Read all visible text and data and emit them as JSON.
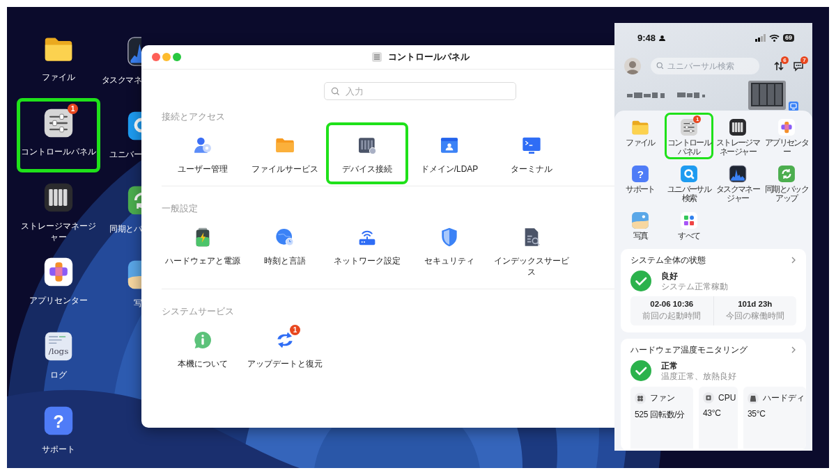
{
  "desktop": {
    "icons": [
      {
        "label": "ファイル",
        "highlighted": false
      },
      {
        "label": "コントロールパネル",
        "badge": "1",
        "highlighted": true
      },
      {
        "label": "ストレージマネージャー",
        "highlighted": false
      },
      {
        "label": "アプリセンター",
        "highlighted": false
      },
      {
        "label": "ログ",
        "icon_text": "/logs",
        "highlighted": false
      },
      {
        "label": "サポート",
        "icon_text": "?",
        "highlighted": false
      }
    ],
    "partly_covered_icons": [
      {
        "label": "タスクマネ"
      },
      {
        "label": "ユニバー"
      },
      {
        "label": "同期とバ"
      },
      {
        "label": "写"
      }
    ]
  },
  "control_panel": {
    "title": "コントロールパネル",
    "search": {
      "placeholder": "入力"
    },
    "sections": [
      {
        "title": "接続とアクセス",
        "items": [
          {
            "label": "ユーザー管理",
            "highlighted": false
          },
          {
            "label": "ファイルサービス",
            "highlighted": false
          },
          {
            "label": "デバイス接続",
            "highlighted": true
          },
          {
            "label": "ドメイン/LDAP",
            "highlighted": false
          },
          {
            "label": "ターミナル",
            "highlighted": false
          }
        ]
      },
      {
        "title": "一般設定",
        "items": [
          {
            "label": "ハードウェアと電源",
            "highlighted": false
          },
          {
            "label": "時刻と言語",
            "highlighted": false
          },
          {
            "label": "ネットワーク設定",
            "highlighted": false
          },
          {
            "label": "セキュリティ",
            "highlighted": false
          },
          {
            "label": "インデックスサービス",
            "highlighted": false
          }
        ]
      },
      {
        "title": "システムサービス",
        "items": [
          {
            "label": "本機について",
            "highlighted": false
          },
          {
            "label": "アップデートと復元",
            "badge": "1",
            "highlighted": false
          }
        ]
      }
    ]
  },
  "phone": {
    "status_bar": {
      "time": "9:48",
      "battery": "69"
    },
    "search": {
      "placeholder": "ユニバーサル検索"
    },
    "transfer_badge": "6",
    "messages_badge": "7",
    "apps": [
      {
        "label": "ファイル",
        "highlighted": false
      },
      {
        "label": "コントロールパネル",
        "badge": "1",
        "highlighted": true
      },
      {
        "label": "ストレージマネージャー",
        "highlighted": false
      },
      {
        "label": "アプリセンター",
        "highlighted": false
      },
      {
        "label": "サポート",
        "icon_text": "?",
        "highlighted": false
      },
      {
        "label": "ユニバーサル検索",
        "highlighted": false
      },
      {
        "label": "タスクマネージャー",
        "highlighted": false
      },
      {
        "label": "同期とバックアップ",
        "highlighted": false
      },
      {
        "label": "写真",
        "highlighted": false
      },
      {
        "label": "すべて",
        "highlighted": false
      }
    ],
    "system_status": {
      "title": "システム全体の状態",
      "state": "良好",
      "detail": "システム正常稼動",
      "stats": [
        {
          "value": "02-06 10:36",
          "label": "前回の起動時間"
        },
        {
          "value": "101d 23h",
          "label": "今回の稼働時間"
        }
      ]
    },
    "hardware": {
      "title": "ハードウェア温度モニタリング",
      "state": "正常",
      "detail": "温度正常、放熱良好",
      "sensors": [
        {
          "name": "ファン",
          "reading": "525 回転数/分"
        },
        {
          "name": "CPU",
          "reading": "43°C"
        },
        {
          "name": "ハードディ",
          "reading": "35°C"
        }
      ]
    }
  }
}
